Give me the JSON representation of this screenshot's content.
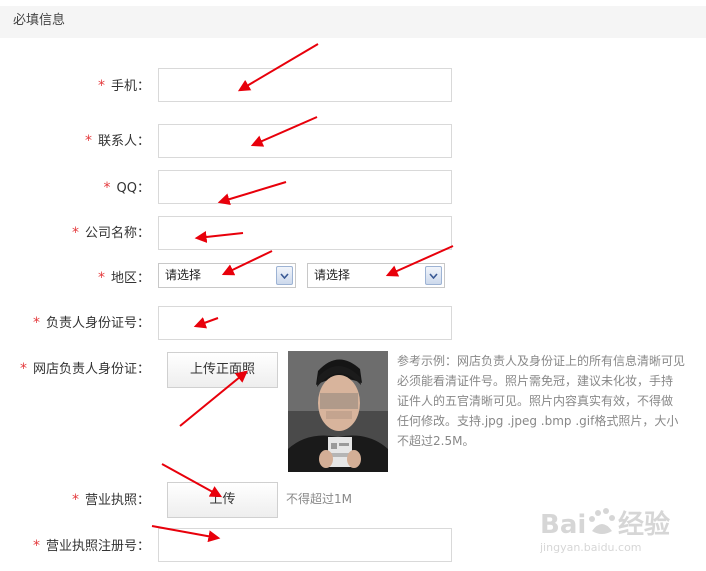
{
  "section": {
    "title": "必填信息"
  },
  "required_mark": "*",
  "fields": {
    "phone": {
      "label": "手机："
    },
    "contact": {
      "label": "联系人："
    },
    "qq": {
      "label": "QQ："
    },
    "company": {
      "label": "公司名称："
    },
    "region": {
      "label": "地区：",
      "select1": "请选择",
      "select2": "请选择"
    },
    "id_number": {
      "label": "负责人身份证号："
    },
    "id_card": {
      "label": "网店负责人身份证：",
      "upload_button": "上传正面照",
      "example_lines": [
        "参考示例：网店负责人及身份证上的所有信息清晰可见",
        "必须能看清证件号。照片需免冠，建议未化妆，手持",
        "证件人的五官清晰可见。照片内容真实有效，不得做",
        "任何修改。支持.jpg .jpeg .bmp .gif格式照片，大小",
        "不超过2.5M。"
      ]
    },
    "license": {
      "label": "营业执照：",
      "upload_button": "上传",
      "hint": "不得超过1M"
    },
    "license_number": {
      "label": "营业执照注册号："
    }
  },
  "watermark": {
    "brand_left": "Bai",
    "brand_right": "经验",
    "url": "jingyan.baidu.com"
  },
  "colors": {
    "required": "#e4393c",
    "arrow": "#e8000b",
    "header_bg": "#f5f5f5"
  }
}
